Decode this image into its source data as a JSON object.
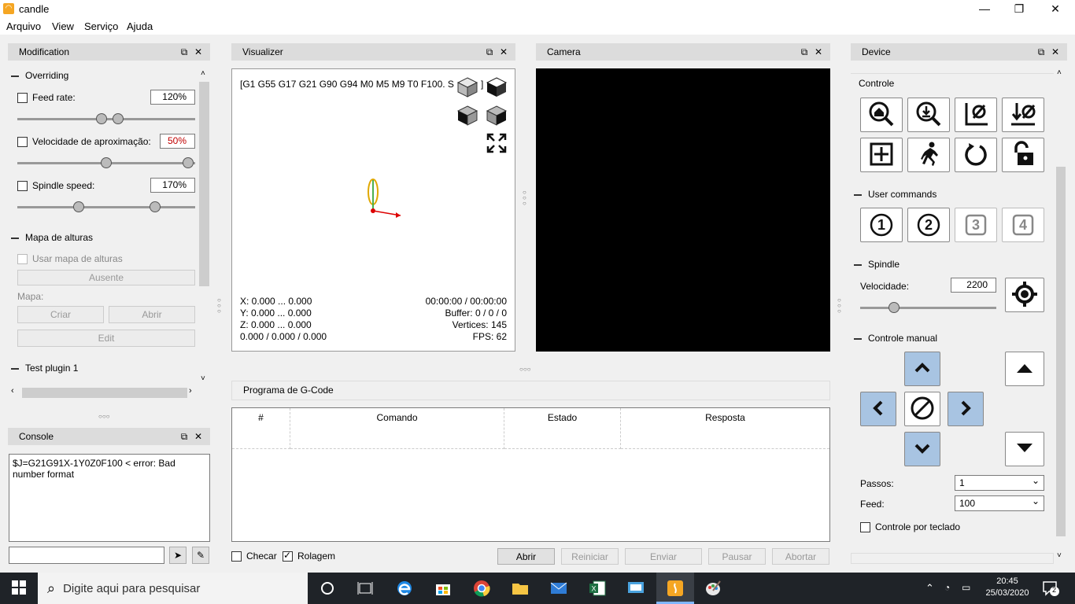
{
  "window": {
    "title": "candle",
    "min": "—",
    "max": "❐",
    "close": "✕"
  },
  "menu": [
    "Arquivo",
    "View",
    "Serviço",
    "Ajuda"
  ],
  "modification": {
    "title": "Modification",
    "overriding": "Overriding",
    "feed_label": "Feed rate:",
    "feed_value": "120%",
    "feed_level": 0.6,
    "rapid_label": "Velocidade de aproximação:",
    "rapid_value": "50%",
    "rapid_level": 0.5,
    "spindle_label": "Spindle speed:",
    "spindle_value": "170%",
    "spindle_level": 0.77,
    "heightmap": "Mapa de alturas",
    "use_heightmap": "Usar mapa de alturas",
    "absent": "Ausente",
    "map_label": "Mapa:",
    "create": "Criar",
    "open": "Abrir",
    "edit": "Edit",
    "test_plugin": "Test plugin 1"
  },
  "console": {
    "title": "Console",
    "text": "$J=G21G91X-1Y0Z0F100 < error: Bad number format",
    "input": ""
  },
  "visualizer": {
    "title": "Visualizer",
    "gcode_state": "[G1 G55 G17 G21 G90 G94 M0 M5 M9 T0 F100. S",
    "gcode_state_end": "]",
    "x": "X: 0.000 ... 0.000",
    "y": "Y: 0.000 ... 0.000",
    "z": "Z: 0.000 ... 0.000",
    "coords": "0.000 / 0.000 / 0.000",
    "time": "00:00:00 / 00:00:00",
    "buffer": "Buffer: 0 / 0 / 0",
    "vertices": "Vertices: 145",
    "fps": "FPS: 62"
  },
  "camera": {
    "title": "Camera"
  },
  "gcode": {
    "title": "Programa de G-Code",
    "columns": [
      "#",
      "Comando",
      "Estado",
      "Resposta"
    ],
    "check": "Checar",
    "scroll": "Rolagem",
    "buttons": [
      "Abrir",
      "Reiniciar",
      "Enviar",
      "Pausar",
      "Abortar"
    ]
  },
  "device": {
    "title": "Device",
    "control": "Controle",
    "user_commands": "User commands",
    "user_buttons": [
      "1",
      "2",
      "3",
      "4"
    ],
    "spindle": "Spindle",
    "speed_label": "Velocidade:",
    "speed_value": "2200",
    "speed_level": 0.2,
    "manual": "Controle manual",
    "steps_label": "Passos:",
    "steps_value": "1",
    "feed_label": "Feed:",
    "feed_value": "100",
    "keyboard": "Controle por teclado"
  },
  "taskbar": {
    "search": "Digite aqui para pesquisar",
    "time": "20:45",
    "date": "25/03/2020",
    "notifications": "2"
  },
  "colors": {
    "accent_red": "#c00000",
    "jog_blue": "#a8c4e2"
  }
}
